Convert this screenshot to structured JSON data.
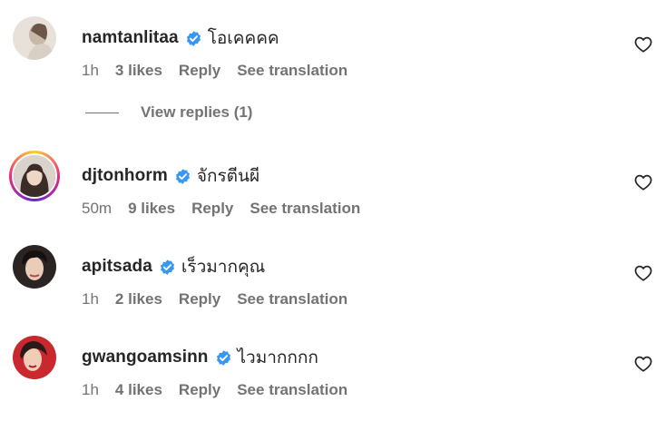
{
  "comments": [
    {
      "username": "namtanlitaa",
      "text": "โอเคคคค",
      "time": "1h",
      "likes": "3 likes",
      "reply": "Reply",
      "translate": "See translation",
      "verified": true,
      "story_ring": false
    },
    {
      "username": "djtonhorm",
      "text": "จักรตีนผี",
      "time": "50m",
      "likes": "9 likes",
      "reply": "Reply",
      "translate": "See translation",
      "verified": true,
      "story_ring": true
    },
    {
      "username": "apitsada",
      "text": "เร็วมากคุณ",
      "time": "1h",
      "likes": "2 likes",
      "reply": "Reply",
      "translate": "See translation",
      "verified": true,
      "story_ring": false
    },
    {
      "username": "gwangoamsinn",
      "text": "ไวมากกกก",
      "time": "1h",
      "likes": "4 likes",
      "reply": "Reply",
      "translate": "See translation",
      "verified": true,
      "story_ring": false
    }
  ],
  "view_replies": {
    "label": "View replies (1)"
  },
  "colors": {
    "verified": "#3897f0",
    "meta_text": "#737373",
    "primary_text": "#262626"
  },
  "icons": {
    "verified": "verified-badge-icon",
    "like": "heart-outline-icon"
  }
}
